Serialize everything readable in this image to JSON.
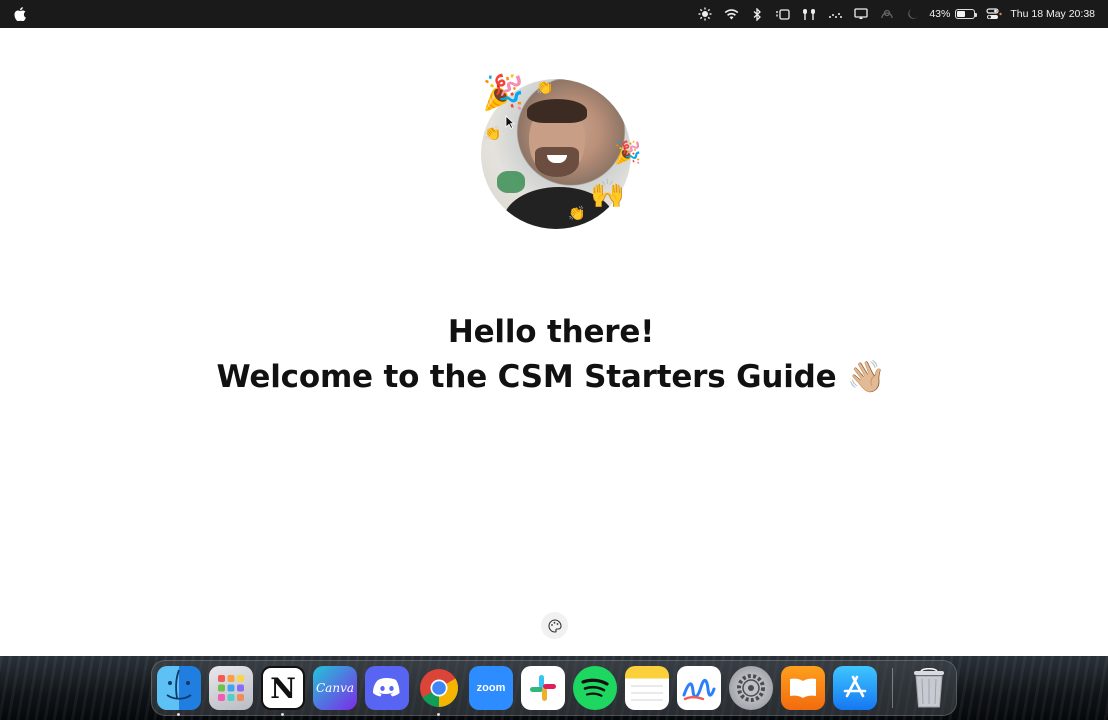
{
  "menubar": {
    "battery_percent": "43%",
    "battery_level": 0.43,
    "datetime": "Thu 18 May  20:38",
    "status_icons": [
      "brightness-icon",
      "wifi-icon",
      "bluetooth-icon",
      "stage-manager-icon",
      "airpods-icon",
      "audio-icon",
      "display-icon",
      "focus-icon",
      "moon-icon"
    ]
  },
  "page": {
    "greeting": "Hello there!",
    "subtitle": "Welcome to the CSM Starters Guide 👋🏼",
    "avatar_emojis": [
      "🎉",
      "👏",
      "👏",
      "🎉",
      "🙌",
      "👏"
    ]
  },
  "dock": {
    "apps": [
      {
        "name": "Finder",
        "label": ""
      },
      {
        "name": "Launchpad",
        "label": ""
      },
      {
        "name": "Notion",
        "label": "N"
      },
      {
        "name": "Canva",
        "label": "Canva"
      },
      {
        "name": "Discord",
        "label": ""
      },
      {
        "name": "Chrome",
        "label": ""
      },
      {
        "name": "Zoom",
        "label": "zoom"
      },
      {
        "name": "Slack",
        "label": ""
      },
      {
        "name": "Spotify",
        "label": ""
      },
      {
        "name": "Notes",
        "label": ""
      },
      {
        "name": "Freeform",
        "label": ""
      },
      {
        "name": "System Settings",
        "label": ""
      },
      {
        "name": "Books",
        "label": ""
      },
      {
        "name": "App Store",
        "label": ""
      },
      {
        "name": "Trash",
        "label": ""
      }
    ]
  }
}
